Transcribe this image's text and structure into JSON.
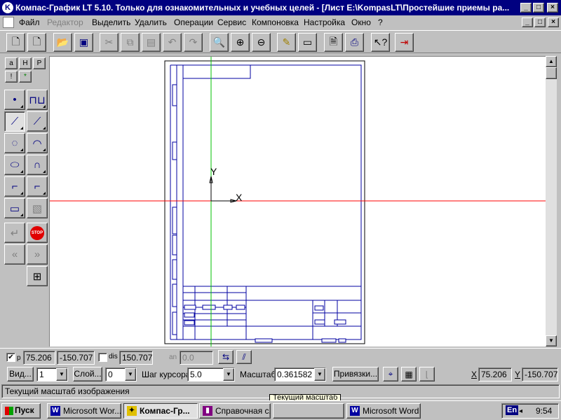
{
  "window": {
    "title": "Компас-График LT 5.10. Только для ознакомительных и учебных целей - [Лист E:\\KompasLT\\Простейшие приемы ра...",
    "app_icon": "K",
    "controls": [
      "_",
      "□",
      "×"
    ]
  },
  "menu": {
    "items": [
      "Файл",
      "Редактор",
      "Выделить",
      "Удалить",
      "Операции",
      "Сервис",
      "Компоновка",
      "Настройка",
      "Окно",
      "?"
    ],
    "disabled": [
      "Редактор"
    ]
  },
  "toolbar": {
    "icons": [
      "new-document-icon",
      "new-fragment-icon",
      "open-folder-icon",
      "save-icon",
      "cut-icon",
      "copy-icon",
      "paste-icon",
      "undo-icon",
      "redo-icon",
      "zoom-icon",
      "zoom-in-icon",
      "zoom-out-icon",
      "pan-icon",
      "scale-icon",
      "print-preview-icon",
      "print-icon",
      "help-cursor-icon",
      "exit-icon"
    ]
  },
  "left_tabs": [
    "a",
    "H",
    "P",
    "!",
    "*"
  ],
  "left_tools": [
    "point-icon",
    "auxiliary-line-icon",
    "line-segment-icon",
    "polyline-icon",
    "circle-icon",
    "arc-icon",
    "ellipse-icon",
    "bezier-icon",
    "fillet-icon",
    "chamfer-icon",
    "rectangle-icon",
    "hatch-icon",
    "enter-icon",
    "stop-icon",
    "prev-icon",
    "next-icon",
    "snap-icon"
  ],
  "drawing": {
    "axis_x_label": "X",
    "axis_y_label": "Y"
  },
  "coords": {
    "p_label": "p",
    "p_x": "75.206",
    "p_y": "-150.707",
    "dis_label": "dis",
    "dis_value": "150.7073",
    "an_label": "an",
    "an_value": "0.0"
  },
  "status": {
    "view_button": "Вид...",
    "view_value": "1",
    "layer_button": "Слой...",
    "layer_value": "0",
    "cursor_step_label": "Шаг курсора",
    "cursor_step_value": "5.0",
    "scale_label": "Масштаб",
    "scale_value": "0.361582",
    "snaps_button": "Привязки...",
    "x_label": "X",
    "x_value": "75.206",
    "y_label": "Y",
    "y_value": "-150.707"
  },
  "hint": "Текущий масштаб изображения",
  "tooltip": "Текущий масштаб",
  "taskbar": {
    "start": "Пуск",
    "tasks": [
      {
        "label": "Microsoft Wor...",
        "active": false
      },
      {
        "label": "Компас-Гр...",
        "active": true
      },
      {
        "label": "Справочная с...",
        "active": false
      },
      {
        "label": "",
        "active": false
      },
      {
        "label": "Microsoft Word",
        "active": false
      }
    ],
    "lang": "En",
    "time": "9:54"
  },
  "colors": {
    "titlebar": "#000080",
    "axis_red": "#ff0000",
    "axis_green": "#00c000",
    "frame_blue": "#0000a0"
  }
}
